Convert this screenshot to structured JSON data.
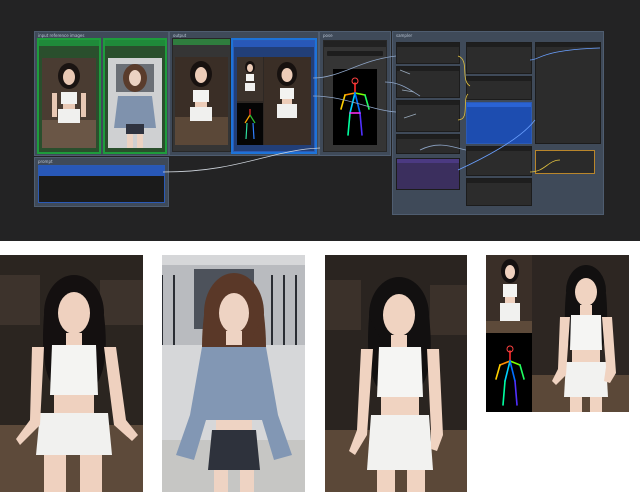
{
  "canvas": {
    "background": "#232324",
    "accent_green": "#1e9c3c",
    "accent_blue": "#2858b8",
    "groups": [
      {
        "title": "input reference images"
      },
      {
        "title": "output"
      },
      {
        "title": "pose"
      },
      {
        "title": "sampler"
      },
      {
        "title": "prompt"
      }
    ]
  },
  "icons": [
    "pose-skeleton-icon"
  ],
  "photos": [
    {
      "name": "photo-1",
      "label": "seated woman in white crop top and white shorts, dark cafe background"
    },
    {
      "name": "photo-2",
      "label": "woman in grey knit off-shoulder sweater and denim shorts, street background"
    },
    {
      "name": "photo-3",
      "label": "seated woman in white crop top and white shorts, generated variant"
    },
    {
      "name": "photo-4",
      "label": "collage: reference image, openpose skeleton and generated image"
    }
  ]
}
